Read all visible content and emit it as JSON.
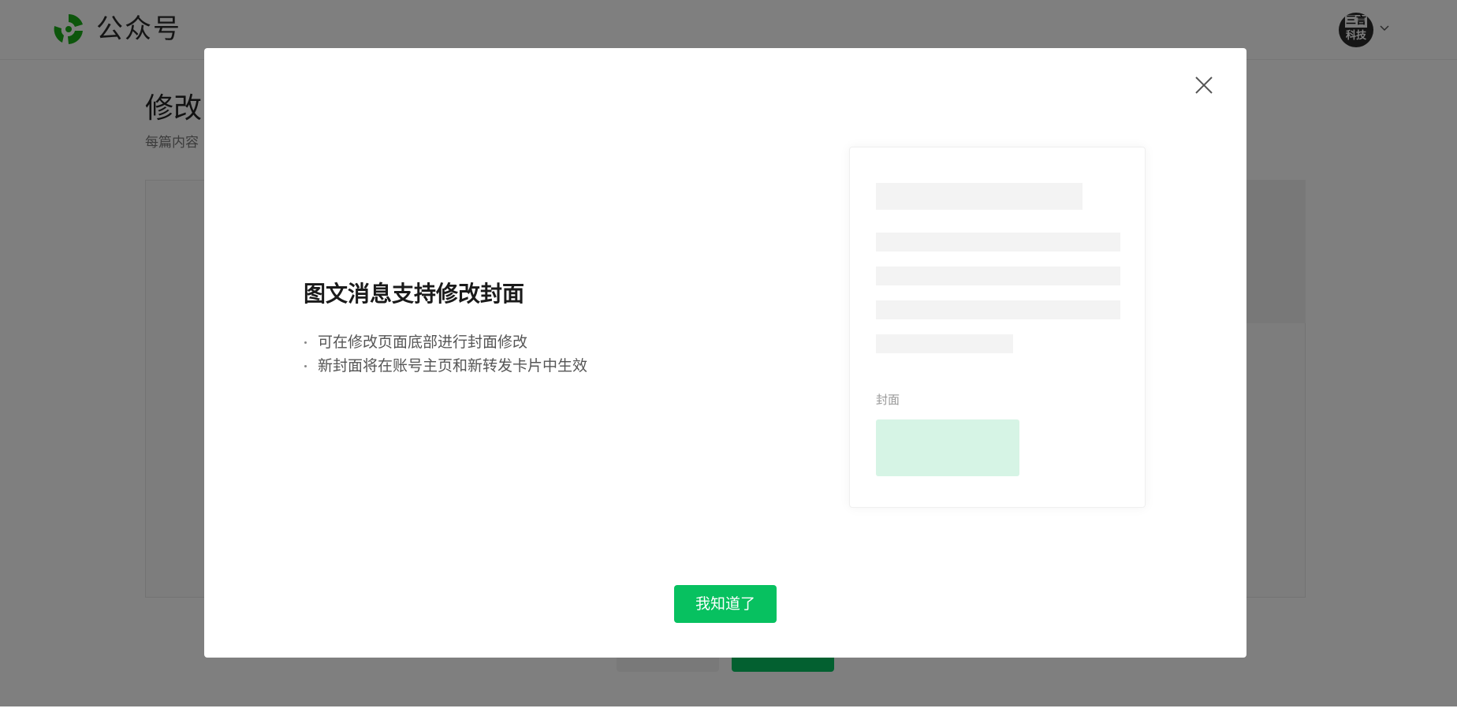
{
  "header": {
    "brand": "公众号",
    "avatar_top": "三言",
    "avatar_bottom": "科技",
    "icons": {
      "logo": "wechat-official-account-logo",
      "avatar_menu": "chevron-down-icon"
    }
  },
  "page": {
    "title": "修改",
    "subtitle": "每篇内容"
  },
  "dialog": {
    "title": "图文消息支持修改封面",
    "bullets": [
      "可在修改页面底部进行封面修改",
      "新封面将在账号主页和新转发卡片中生效"
    ],
    "preview_cover_label": "封面",
    "ok_label": "我知道了",
    "close_icon": "close-icon"
  },
  "colors": {
    "accent": "#07c160",
    "cover_placeholder": "#d6f4e5",
    "overlay": "rgba(0,0,0,0.5)"
  }
}
